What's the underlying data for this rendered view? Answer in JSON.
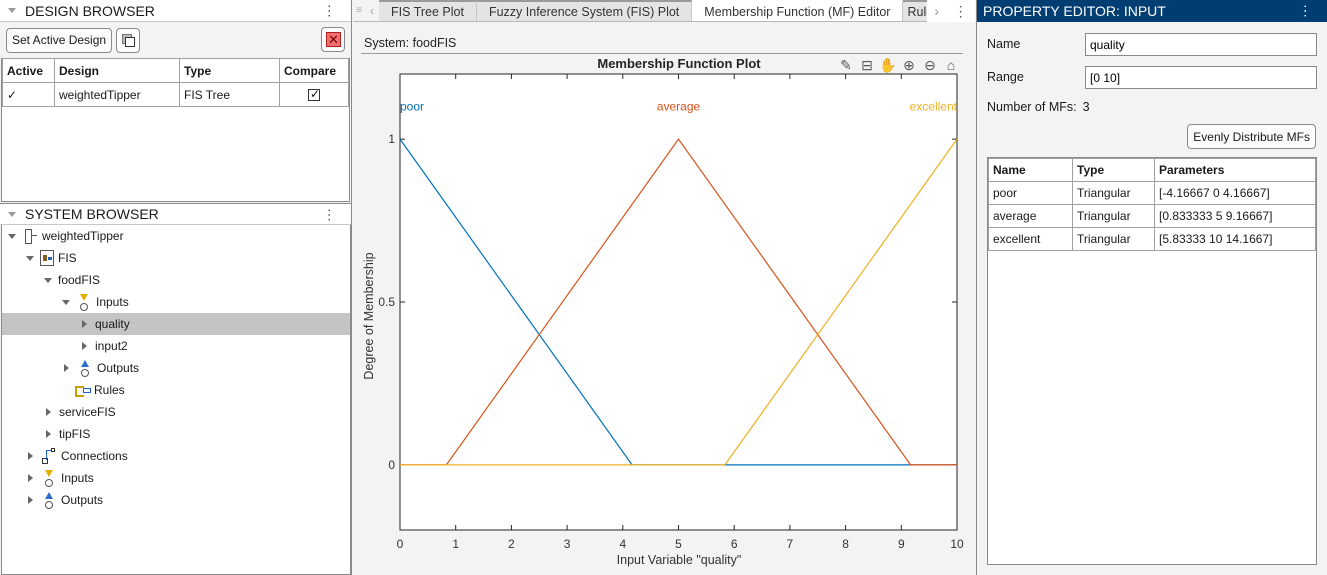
{
  "design_browser": {
    "title": "DESIGN BROWSER",
    "set_active_label": "Set Active Design",
    "columns": [
      "Active",
      "Design",
      "Type",
      "Compare"
    ],
    "rows": [
      {
        "active": "✓",
        "design": "weightedTipper",
        "type": "FIS Tree",
        "compare": true
      }
    ]
  },
  "system_browser": {
    "title": "SYSTEM BROWSER",
    "tree": [
      {
        "label": "weightedTipper",
        "icon": "fis-tree-icon",
        "level": 0,
        "expander": "open"
      },
      {
        "label": "FIS",
        "icon": "fis-icon",
        "level": 1,
        "expander": "open"
      },
      {
        "label": "foodFIS",
        "icon": "",
        "level": 2,
        "expander": "open"
      },
      {
        "label": "Inputs",
        "icon": "inputs-icon",
        "level": 3,
        "expander": "open"
      },
      {
        "label": "quality",
        "icon": "",
        "level": 4,
        "expander": "closed",
        "selected": true
      },
      {
        "label": "input2",
        "icon": "",
        "level": 4,
        "expander": "closed"
      },
      {
        "label": "Outputs",
        "icon": "outputs-icon",
        "level": 3,
        "expander": "closed"
      },
      {
        "label": "Rules",
        "icon": "rules-icon",
        "level": 3,
        "expander": "none"
      },
      {
        "label": "serviceFIS",
        "icon": "",
        "level": 2,
        "expander": "closed"
      },
      {
        "label": "tipFIS",
        "icon": "",
        "level": 2,
        "expander": "closed"
      },
      {
        "label": "Connections",
        "icon": "connections-icon",
        "level": 1,
        "expander": "closed"
      },
      {
        "label": "Inputs",
        "icon": "inputs-icon",
        "level": 1,
        "expander": "closed"
      },
      {
        "label": "Outputs",
        "icon": "outputs-icon",
        "level": 1,
        "expander": "closed"
      }
    ]
  },
  "center": {
    "tabs": [
      {
        "label": "FIS Tree Plot",
        "active": false
      },
      {
        "label": "Fuzzy Inference System (FIS) Plot",
        "active": false
      },
      {
        "label": "Membership Function (MF) Editor",
        "active": true
      },
      {
        "label": "Rule",
        "active": false
      }
    ],
    "system_label": "System: foodFIS",
    "plot_tools": [
      "brush-icon",
      "legend-icon",
      "pan-icon",
      "zoom-in-icon",
      "zoom-out-icon",
      "home-icon"
    ]
  },
  "property_editor": {
    "title": "PROPERTY EDITOR: INPUT",
    "name_label": "Name",
    "name_value": "quality",
    "range_label": "Range",
    "range_value": "[0 10]",
    "num_mfs_label": "Number of MFs:",
    "num_mfs_value": "3",
    "distribute_label": "Evenly Distribute MFs",
    "mf_columns": [
      "Name",
      "Type",
      "Parameters"
    ],
    "mf_rows": [
      {
        "name": "poor",
        "type": "Triangular",
        "params": "[-4.16667 0 4.16667]"
      },
      {
        "name": "average",
        "type": "Triangular",
        "params": "[0.833333 5 9.16667]"
      },
      {
        "name": "excellent",
        "type": "Triangular",
        "params": "[5.83333 10 14.1667]"
      }
    ]
  },
  "chart_data": {
    "type": "line",
    "title": "Membership Function Plot",
    "xlabel": "Input Variable \"quality\"",
    "ylabel": "Degree of Membership",
    "xlim": [
      0,
      10
    ],
    "ylim": [
      -0.2,
      1.2
    ],
    "xticks": [
      0,
      1,
      2,
      3,
      4,
      5,
      6,
      7,
      8,
      9,
      10
    ],
    "yticks": [
      0,
      0.5,
      1
    ],
    "ytick_labels": [
      "0",
      "0.5",
      "1"
    ],
    "grid": false,
    "series": [
      {
        "name": "poor",
        "color": "#0072bd",
        "x": [
          0,
          4.16667,
          10
        ],
        "y": [
          1,
          0,
          0
        ],
        "label_x": 0,
        "label_align": "start"
      },
      {
        "name": "average",
        "color": "#d95319",
        "x": [
          0,
          0.833333,
          5,
          9.16667,
          10
        ],
        "y": [
          0,
          0,
          1,
          0,
          0
        ],
        "label_x": 5,
        "label_align": "middle"
      },
      {
        "name": "excellent",
        "color": "#edb120",
        "x": [
          0,
          5.83333,
          10
        ],
        "y": [
          0,
          0,
          1
        ],
        "label_x": 10,
        "label_align": "end"
      }
    ],
    "label_y": 1.1
  }
}
